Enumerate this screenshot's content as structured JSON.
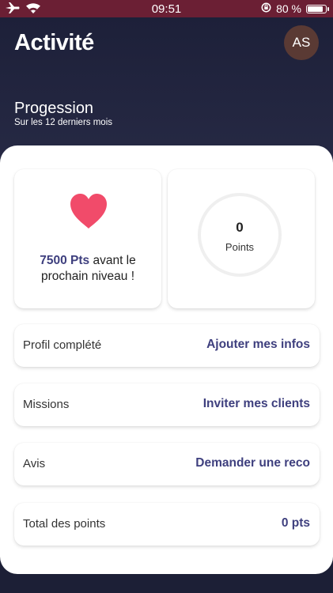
{
  "status_bar": {
    "time": "09:51",
    "battery_percent": "80 %",
    "icons": [
      "airplane-icon",
      "wifi-icon",
      "rotation-lock-icon",
      "battery-icon"
    ]
  },
  "header": {
    "title": "Activité",
    "avatar_initials": "AS"
  },
  "progression": {
    "title": "Progession",
    "subtitle": "Sur les 12 derniers mois"
  },
  "level_card": {
    "icon": "heart-icon",
    "points_amount": "7500 Pts",
    "text_suffix": " avant le prochain niveau !"
  },
  "points_card": {
    "value": "0",
    "label": "Points"
  },
  "rows": [
    {
      "label": "Profil complété",
      "action": "Ajouter mes infos"
    },
    {
      "label": "Missions",
      "action": "Inviter mes clients"
    },
    {
      "label": "Avis",
      "action": "Demander une reco"
    },
    {
      "label": "Total des points",
      "action": "0 pts"
    }
  ],
  "colors": {
    "header_bg": "#1d2039",
    "status_bar_bg": "#6b1f34",
    "accent": "#3e3f7e",
    "heart": "#f14b6a",
    "avatar_bg": "#5a3a34"
  }
}
